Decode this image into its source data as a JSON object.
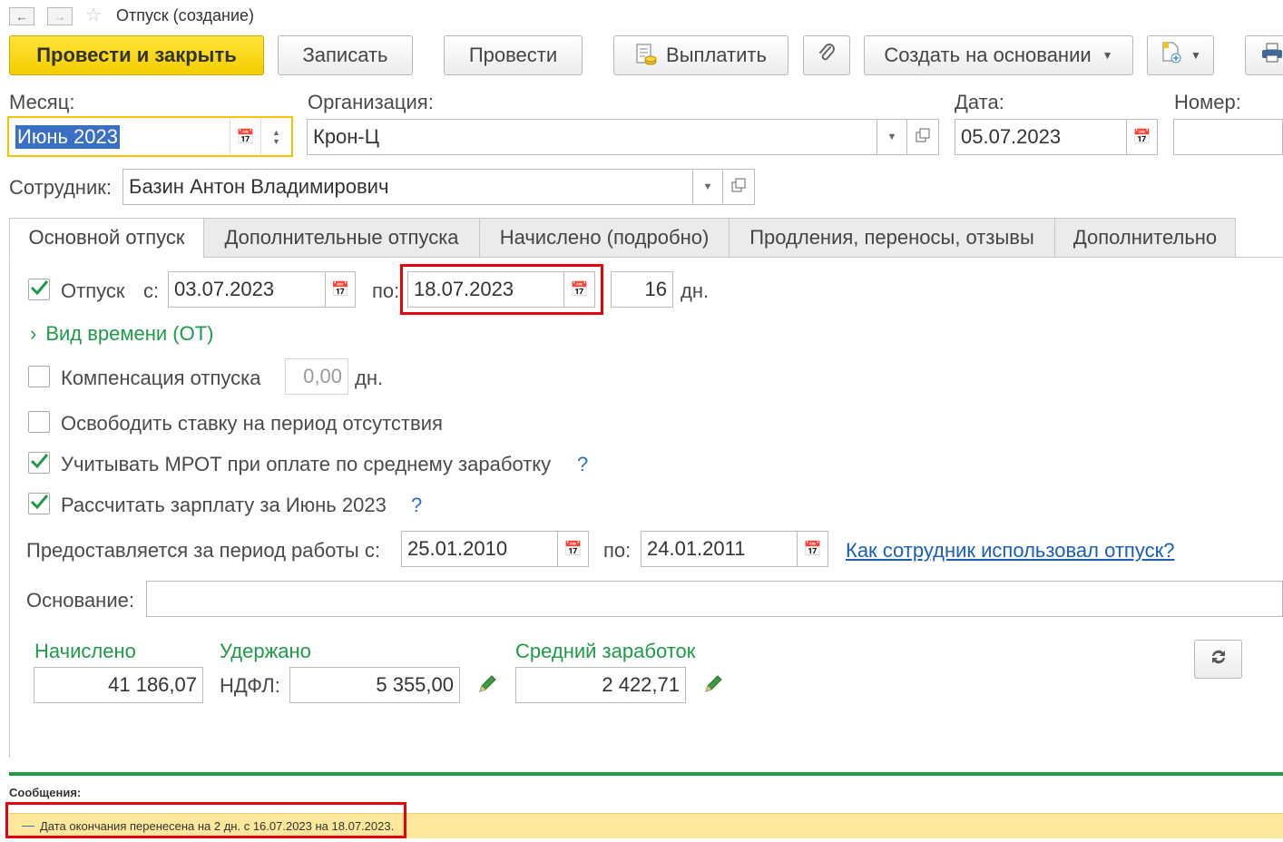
{
  "window": {
    "title": "Отпуск (создание)"
  },
  "toolbar": {
    "post_close": "Провести и закрыть",
    "save": "Записать",
    "post": "Провести",
    "pay": "Выплатить",
    "create_based": "Создать на основании"
  },
  "header": {
    "month_label": "Месяц:",
    "month_value": "Июнь 2023",
    "org_label": "Организация:",
    "org_value": "Крон-Ц",
    "date_label": "Дата:",
    "date_value": "05.07.2023",
    "number_label": "Номер:",
    "number_value": "",
    "employee_label": "Сотрудник:",
    "employee_value": "Базин Антон Владимирович"
  },
  "tabs": [
    {
      "label": "Основной отпуск"
    },
    {
      "label": "Дополнительные отпуска"
    },
    {
      "label": "Начислено (подробно)"
    },
    {
      "label": "Продления, переносы, отзывы"
    },
    {
      "label": "Дополнительно"
    }
  ],
  "main": {
    "vacation_label": "Отпуск",
    "vacation_checked": true,
    "from_label": "с:",
    "from_value": "03.07.2023",
    "to_label": "по:",
    "to_value": "18.07.2023",
    "days_value": "16",
    "days_unit": "дн.",
    "time_kind": "Вид времени (ОТ)",
    "compensation_label": "Компенсация отпуска",
    "compensation_checked": false,
    "compensation_value": "0,00",
    "compensation_unit": "дн.",
    "release_rate_label": "Освободить ставку на период отсутствия",
    "release_rate_checked": false,
    "mrot_label": "Учитывать МРОТ при оплате по среднему заработку",
    "mrot_checked": true,
    "calc_salary_label": "Рассчитать зарплату за Июнь 2023",
    "calc_salary_checked": true,
    "help_mark": "?",
    "period_label": "Предоставляется за период работы с:",
    "period_from": "25.01.2010",
    "period_to_label": "по:",
    "period_to": "24.01.2011",
    "usage_link": "Как сотрудник использовал отпуск?",
    "basis_label": "Основание:",
    "basis_value": ""
  },
  "totals": {
    "accrued_label": "Начислено",
    "accrued_value": "41 186,07",
    "withheld_label": "Удержано",
    "ndfl_label": "НДФЛ:",
    "ndfl_value": "5 355,00",
    "avg_label": "Средний заработок",
    "avg_value": "2 422,71"
  },
  "messages": {
    "title": "Сообщения:",
    "items": [
      "Дата окончания перенесена на 2 дн. с 16.07.2023 на 18.07.2023."
    ]
  },
  "colors": {
    "accent_green": "#1f9a48",
    "primary_button": "#f4cd00",
    "highlight_red": "#e8000b",
    "message_bg": "#fce79a"
  }
}
